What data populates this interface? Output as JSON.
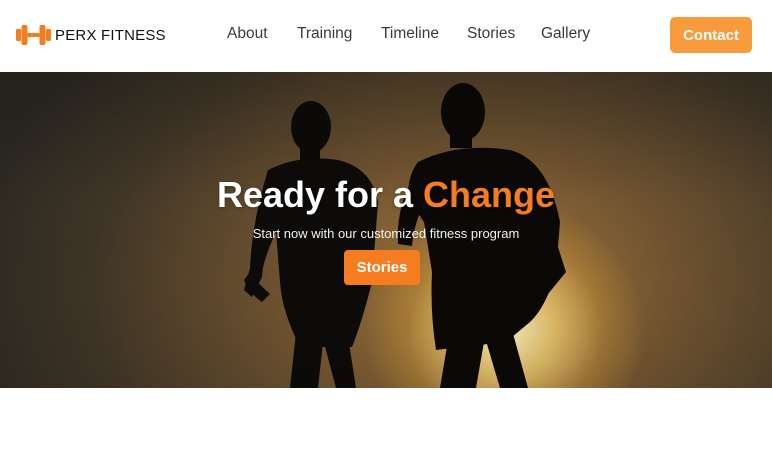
{
  "colors": {
    "accent": "#f57c1f",
    "contact_button": "#f89b3c",
    "nav_text": "#3a3a3a"
  },
  "header": {
    "logo_icon": "dumbbell-icon",
    "logo_text": "PERX FITNESS",
    "nav": [
      {
        "label": "About"
      },
      {
        "label": "Training"
      },
      {
        "label": "Timeline"
      },
      {
        "label": "Stories"
      },
      {
        "label": "Gallery"
      }
    ],
    "contact_label": "Contact"
  },
  "hero": {
    "background": "silhouette of two runners against sunset",
    "title_part1": "Ready for a ",
    "title_highlight": "Change",
    "subtitle": "Start now with our customized fitness program",
    "button_label": "Stories"
  }
}
